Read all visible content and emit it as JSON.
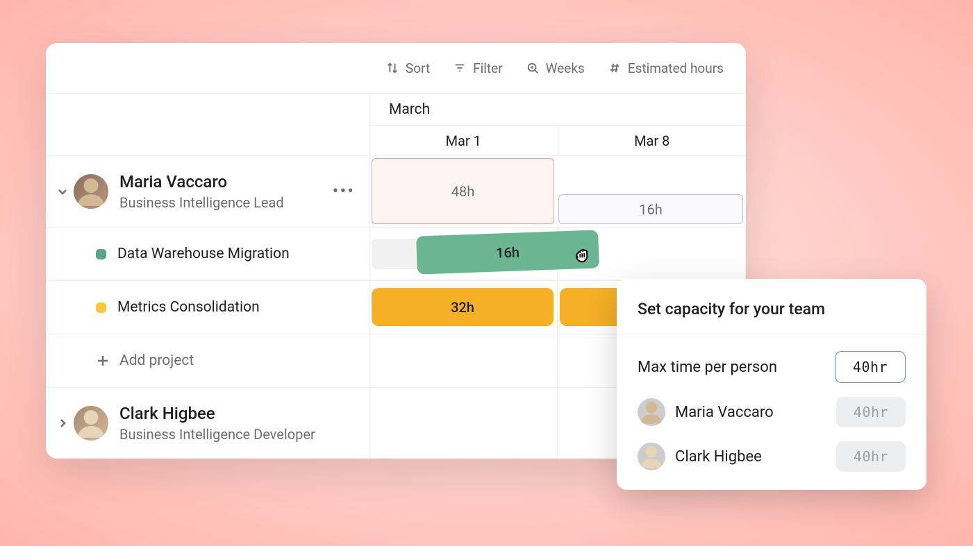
{
  "toolbar": {
    "sort": "Sort",
    "filter": "Filter",
    "zoom": "Weeks",
    "measure": "Estimated hours"
  },
  "timeline": {
    "month": "March",
    "weeks": [
      "Mar 1",
      "Mar 8"
    ]
  },
  "people": [
    {
      "name": "Maria Vaccaro",
      "role": "Business Intelligence Lead",
      "expanded": true,
      "capacity": [
        "48h",
        "16h"
      ],
      "projects": [
        {
          "name": "Data Warehouse Migration",
          "color": "green",
          "blocks": [
            {
              "label": "16h"
            }
          ]
        },
        {
          "name": "Metrics Consolidation",
          "color": "yellow",
          "blocks": [
            {
              "label": "32h"
            },
            {
              "label": ""
            }
          ]
        }
      ]
    },
    {
      "name": "Clark Higbee",
      "role": "Business Intelligence Developer",
      "expanded": false
    }
  ],
  "add_project_label": "Add project",
  "popup": {
    "title": "Set capacity for your team",
    "max_label": "Max time per person",
    "max_value": "40hr",
    "members": [
      {
        "name": "Maria Vaccaro",
        "hours": "40hr"
      },
      {
        "name": "Clark Higbee",
        "hours": "40hr"
      }
    ]
  }
}
